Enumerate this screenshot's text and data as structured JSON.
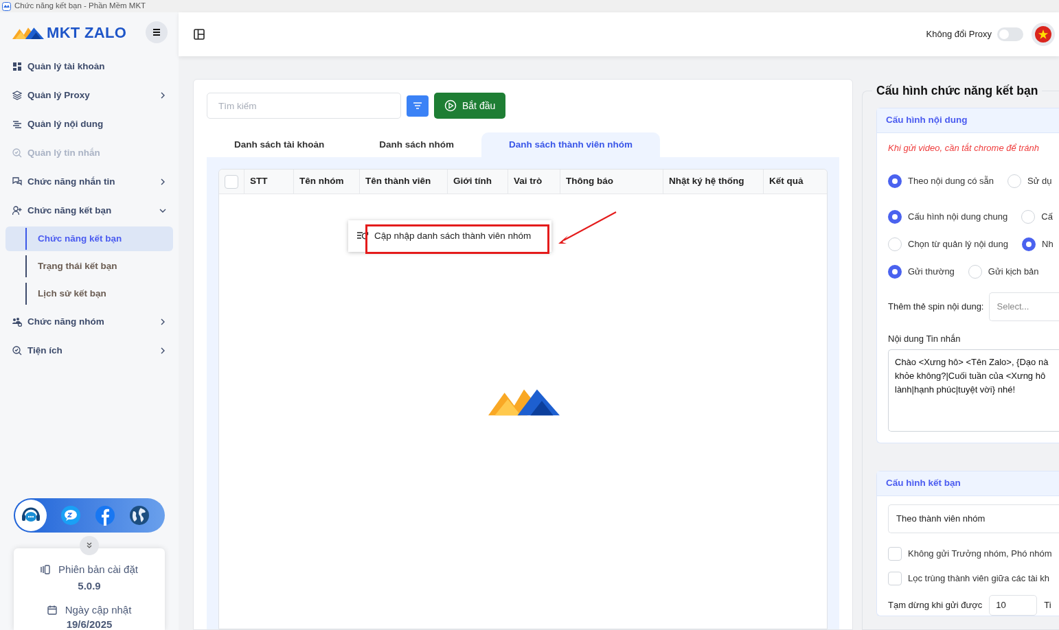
{
  "window": {
    "title": "Chức năng kết bạn - Phần Mềm MKT"
  },
  "sidebar": {
    "logo": "MKT ZALO",
    "items": [
      {
        "label": "Quản lý tài khoản",
        "disabled": false
      },
      {
        "label": "Quản lý Proxy",
        "expanded": false,
        "disabled": false
      },
      {
        "label": "Quản lý nội dung",
        "disabled": false
      },
      {
        "label": "Quản lý tin nhắn",
        "disabled": true
      },
      {
        "label": "Chức năng nhắn tin",
        "expanded": false,
        "disabled": false
      },
      {
        "label": "Chức năng kết bạn",
        "expanded": true,
        "disabled": false,
        "children": [
          {
            "label": "Chức năng kết bạn",
            "selected": true
          },
          {
            "label": "Trạng thái kết bạn",
            "selected": false
          },
          {
            "label": "Lịch sử kết bạn",
            "selected": false
          }
        ]
      },
      {
        "label": "Chức năng nhóm",
        "expanded": false,
        "disabled": false
      },
      {
        "label": "Tiện ích",
        "expanded": false,
        "disabled": false
      }
    ],
    "info": [
      {
        "label": "Phiên bản cài đặt",
        "value": "5.0.9"
      },
      {
        "label": "Ngày cập nhật",
        "value": "19/6/2025"
      }
    ]
  },
  "header": {
    "proxy_label": "Không đổi Proxy",
    "proxy_on": false
  },
  "toolbar": {
    "search": {
      "placeholder": "Tìm kiếm"
    },
    "start_button": "Bắt đầu"
  },
  "tabs": [
    {
      "label": "Danh sách tài khoản",
      "selected": false
    },
    {
      "label": "Danh sách nhóm",
      "selected": false
    },
    {
      "label": "Danh sách thành viên nhóm",
      "selected": true
    }
  ],
  "table": {
    "select_all_checked": false,
    "columns": [
      "STT",
      "Tên nhóm",
      "Tên thành viên",
      "Giới tính",
      "Vai trò",
      "Thông báo",
      "Nhật ký hệ thống",
      "Kết quả"
    ]
  },
  "context_menu": {
    "items": [
      "Cập nhập danh sách thành viên nhóm"
    ]
  },
  "config": {
    "legend": "Cấu hình chức năng kết bạn",
    "content_section": {
      "title": "Cấu hình nội dung",
      "warning": "Khi gửi video, cần tắt chrome để tránh",
      "radio_groups": [
        [
          {
            "label": "Theo nội dung có sẵn",
            "selected": true
          },
          {
            "label": "Sử dụ",
            "selected": false
          }
        ],
        [
          {
            "label": "Cấu hình nội dung chung",
            "selected": true
          },
          {
            "label": "Cấ",
            "selected": false
          }
        ],
        [
          {
            "label": "Chọn từ quản lý nội dung",
            "selected": false
          },
          {
            "label": "Nh",
            "selected": true
          }
        ],
        [
          {
            "label": "Gửi thường",
            "selected": true
          },
          {
            "label": "Gửi kịch bản",
            "selected": false
          }
        ]
      ],
      "spin_label": "Thêm thẻ spin nội dung:",
      "spin_placeholder": "Select...",
      "message_label": "Nội dung Tin nhắn",
      "message_lines": [
        "Chào <Xưng hô> <Tên Zalo>, {Dạo nà",
        "khỏe không?|Cuối tuần của <Xưng hô",
        "lành|hạnh phúc|tuyệt vời} nhé!"
      ]
    },
    "friend_section": {
      "title": "Cấu hình kết bạn",
      "mode": "Theo thành viên nhóm",
      "checkboxes": [
        {
          "label": "Không gửi Trưởng nhóm, Phó nhóm",
          "checked": false
        },
        {
          "label": "Lọc trùng thành viên giữa các tài kh",
          "checked": false
        }
      ],
      "pause_label": "Tạm dừng khi gửi được",
      "pause_value": "10",
      "pause_unit": "Ti"
    }
  }
}
